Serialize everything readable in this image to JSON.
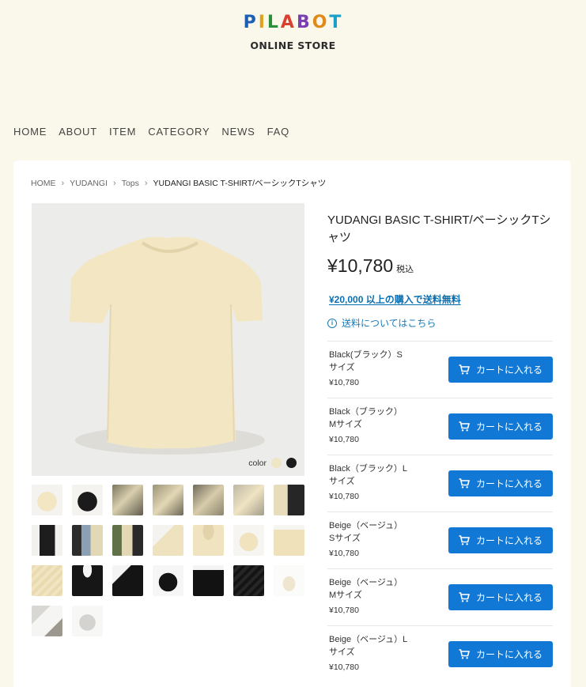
{
  "brand": {
    "logo_letters": [
      {
        "ch": "P",
        "color": "#1a5fb4"
      },
      {
        "ch": "I",
        "color": "#e0a21a"
      },
      {
        "ch": "L",
        "color": "#2a8f3a"
      },
      {
        "ch": "A",
        "color": "#d8412f"
      },
      {
        "ch": "B",
        "color": "#7a3fb0"
      },
      {
        "ch": "O",
        "color": "#e08a1a"
      },
      {
        "ch": "T",
        "color": "#1aa0c8"
      }
    ],
    "subtitle": "ONLINE STORE"
  },
  "nav": {
    "items": [
      "HOME",
      "ABOUT",
      "ITEM",
      "CATEGORY",
      "NEWS",
      "FAQ"
    ]
  },
  "breadcrumb": {
    "items": [
      "HOME",
      "YUDANGI",
      "Tops",
      "YUDANGI BASIC T-SHIRT/ベーシックTシャツ"
    ]
  },
  "product": {
    "title": "YUDANGI BASIC T-SHIRT/ベーシックTシャツ",
    "price": "¥10,780",
    "tax_label": "税込",
    "free_shipping": "¥20,000 以上の購入で送料無料",
    "shipping_info": "送料についてはこちら",
    "color_label": "color",
    "colors": [
      "#efe6c6",
      "#1b1b1b"
    ]
  },
  "thumbnails": [
    "beige-flat",
    "black-flat",
    "model-beige-1",
    "model-beige-2",
    "model-beige-3",
    "model-beige-4",
    "model-pair",
    "model-black-1",
    "model-group-1",
    "model-group-2",
    "beige-sleeve",
    "beige-collar",
    "beige-front",
    "beige-fold",
    "beige-fabric",
    "black-collar",
    "black-sleeve",
    "black-front",
    "black-fold",
    "black-fabric",
    "bag",
    "package-1",
    "package-2"
  ],
  "variants": [
    {
      "name": "Black(ブラック）S サイズ",
      "price": "¥10,780",
      "button": "カートに入れる"
    },
    {
      "name": "Black（ブラック）Mサイズ",
      "price": "¥10,780",
      "button": "カートに入れる"
    },
    {
      "name": "Black（ブラック）Lサイズ",
      "price": "¥10,780",
      "button": "カートに入れる"
    },
    {
      "name": "Beige（ベージュ）Sサイズ",
      "price": "¥10,780",
      "button": "カートに入れる"
    },
    {
      "name": "Beige（ベージュ）Mサイズ",
      "price": "¥10,780",
      "button": "カートに入れる"
    },
    {
      "name": "Beige（ベージュ）Lサイズ",
      "price": "¥10,780",
      "button": "カートに入れる"
    }
  ]
}
